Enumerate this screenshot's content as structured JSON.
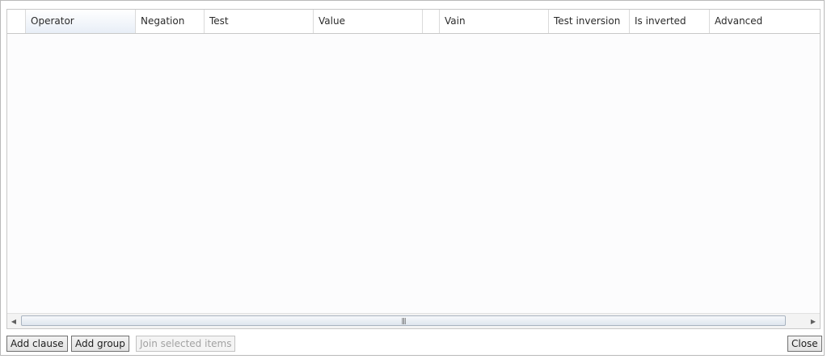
{
  "grid": {
    "columns": [
      {
        "key": "operator",
        "label": "Operator"
      },
      {
        "key": "negation",
        "label": "Negation"
      },
      {
        "key": "test",
        "label": "Test"
      },
      {
        "key": "value",
        "label": "Value"
      },
      {
        "key": "blank",
        "label": ""
      },
      {
        "key": "vain",
        "label": "Vain"
      },
      {
        "key": "test_inversion",
        "label": "Test inversion"
      },
      {
        "key": "is_inverted",
        "label": "Is inverted"
      },
      {
        "key": "advanced",
        "label": "Advanced"
      }
    ],
    "rows": []
  },
  "scrollbar": {
    "left_arrow_icon": "left-arrow",
    "right_arrow_icon": "right-arrow",
    "grip_icon": "grip"
  },
  "buttons": {
    "add_clause": "Add clause",
    "add_group": "Add group",
    "join_selected": "Join selected items",
    "close": "Close"
  }
}
